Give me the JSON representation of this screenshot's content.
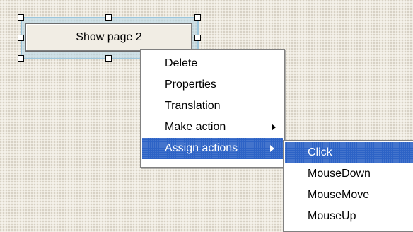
{
  "widget": {
    "button_label": "Show page 2"
  },
  "context_menu": {
    "items": [
      {
        "label": "Delete"
      },
      {
        "label": "Properties"
      },
      {
        "label": "Translation"
      },
      {
        "label": "Make action",
        "has_submenu": true
      },
      {
        "label": "Assign actions",
        "has_submenu": true,
        "highlighted": true
      }
    ]
  },
  "submenu": {
    "items": [
      {
        "label": "Click",
        "highlighted": true
      },
      {
        "label": "MouseDown"
      },
      {
        "label": "MouseMove"
      },
      {
        "label": "MouseUp"
      }
    ]
  },
  "colors": {
    "highlight": "#2d63c6",
    "selection": "#b0d4e6",
    "surface": "#eeeae0"
  },
  "icons": {
    "submenu_arrow": "chevron-right-icon",
    "resize_handle": "resize-handle-icon"
  }
}
